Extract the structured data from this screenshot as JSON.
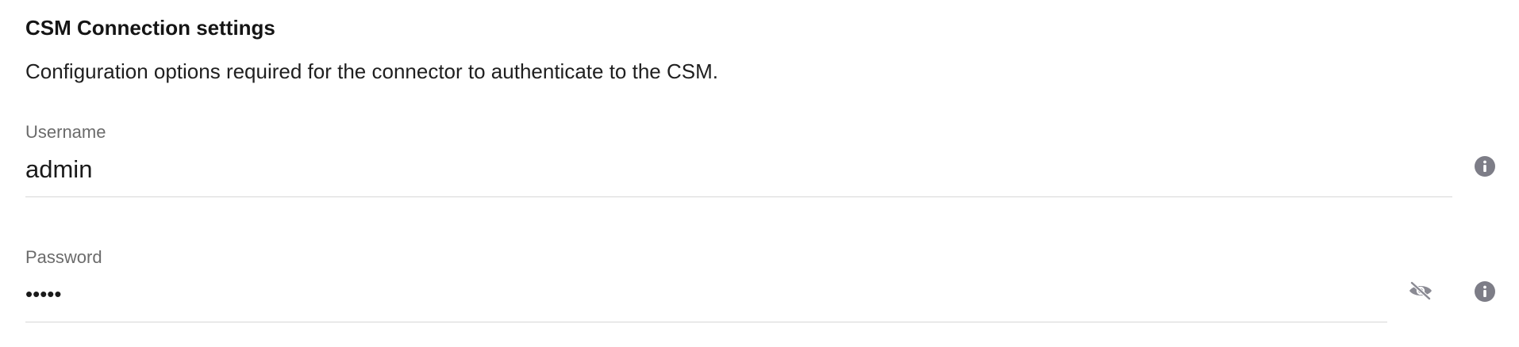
{
  "section": {
    "title": "CSM Connection settings",
    "description": "Configuration options required for the connector to authenticate to the CSM."
  },
  "fields": {
    "username": {
      "label": "Username",
      "value": "admin",
      "info_icon": "info-icon"
    },
    "password": {
      "label": "Password",
      "value": "•••••",
      "visibility_icon": "eye-slash-icon",
      "info_icon": "info-icon"
    }
  },
  "colors": {
    "label": "#6b6b6b",
    "text": "#1a1a1a",
    "underline": "#d7d7d7",
    "icon": "#7d7d87"
  }
}
